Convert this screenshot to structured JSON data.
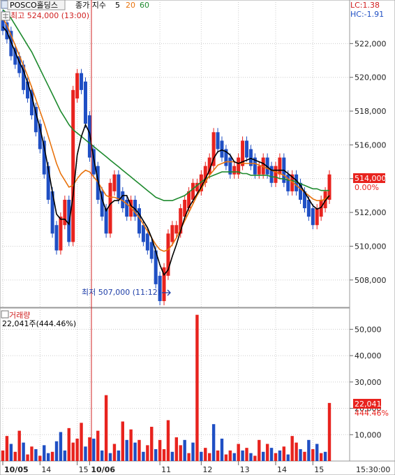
{
  "header": {
    "stock_name": "POSCO홀딩스",
    "series_label": "종가 지수",
    "ma_periods": [
      "5",
      "20",
      "60"
    ],
    "ma_colors": [
      "#000000",
      "#e8720c",
      "#1e8a2e"
    ],
    "high_label": "최고 524,000 (13:00)",
    "lc_label": "LC:1.38",
    "hc_label": "HC:-1.91"
  },
  "price_panel": {
    "current_price_label": "514,000",
    "current_change_label": "0.00%",
    "low_label": "최저 507,000 (11:12)",
    "y_ticks": [
      "522,000",
      "520,000",
      "518,000",
      "516,000",
      "514,000",
      "512,000",
      "510,000",
      "508,000"
    ]
  },
  "volume_panel": {
    "title": "거래량",
    "summary": "22,041주(444.46%)",
    "current_volume_label": "22,041",
    "current_ratio_label": "444.46%",
    "y_ticks": [
      "50,000",
      "40,000",
      "30,000",
      "20,000",
      "10,000"
    ]
  },
  "x_axis": {
    "labels": [
      "10/05",
      "14",
      "15",
      "10/06",
      "11",
      "12",
      "13",
      "14",
      "15"
    ],
    "time_label": "15:30:00"
  },
  "colors": {
    "up": "#e8231e",
    "down": "#1f4fc4",
    "ma5": "#000000",
    "ma20": "#e8720c",
    "ma60": "#1e8a2e",
    "marker": "#d02020",
    "axis_text": "#222222",
    "grid": "#cccccc"
  },
  "chart_data": [
    {
      "type": "bar",
      "title": "POSCO홀딩스 종가 지수",
      "description_series": [
        "close",
        "ma5",
        "ma20",
        "ma60"
      ],
      "x": [
        "10/05",
        "14",
        "15",
        "10/06",
        "11",
        "12",
        "13",
        "14",
        "15"
      ],
      "ylim": [
        507000,
        524000
      ],
      "close": [
        523000,
        522500,
        521500,
        521000,
        520500,
        519500,
        519000,
        518000,
        517000,
        516000,
        514500,
        513000,
        511000,
        510000,
        511500,
        512500,
        510500,
        519000,
        520000,
        519500,
        517500,
        515500,
        514500,
        513000,
        512000,
        511000,
        513500,
        514000,
        513000,
        512500,
        512000,
        512500,
        512000,
        511000,
        510500,
        510000,
        509500,
        508000,
        507000,
        508500,
        510500,
        511000,
        511000,
        512000,
        512500,
        513000,
        513500,
        513500,
        514000,
        514500,
        515000,
        516500,
        516000,
        515500,
        515000,
        514500,
        514500,
        515000,
        516000,
        515500,
        515000,
        514500,
        514500,
        515000,
        514500,
        514000,
        514500,
        515000,
        514000,
        513500,
        514000,
        513500,
        513000,
        512500,
        512000,
        511500,
        512000,
        512500,
        513000,
        514000
      ],
      "ma5": [
        523000,
        522700,
        522100,
        521500,
        520900,
        520400,
        519700,
        518900,
        517900,
        517000,
        515900,
        514600,
        513200,
        511900,
        511600,
        511600,
        511300,
        513000,
        515400,
        516500,
        517200,
        516700,
        515200,
        513900,
        512800,
        512100,
        512500,
        512700,
        512700,
        513000,
        513000,
        512400,
        512200,
        511900,
        511500,
        511100,
        510500,
        509700,
        508900,
        508300,
        508600,
        509400,
        510100,
        510900,
        511700,
        512300,
        512700,
        513100,
        513500,
        514000,
        514500,
        515200,
        515600,
        515700,
        515600,
        515400,
        515000,
        514900,
        515000,
        515100,
        515200,
        515100,
        515000,
        514900,
        514700,
        514500,
        514500,
        514500,
        514500,
        514300,
        514100,
        513900,
        513600,
        513200,
        512800,
        512400,
        512200,
        512300,
        512700,
        513000
      ],
      "ma20": [
        523500,
        523100,
        522500,
        521900,
        521300,
        520700,
        520100,
        519400,
        518700,
        518000,
        517300,
        516500,
        515700,
        514900,
        514300,
        513900,
        513500,
        513600,
        514000,
        514300,
        514500,
        514400,
        514100,
        513800,
        513400,
        513000,
        512900,
        512900,
        512800,
        512700,
        512500,
        512300,
        512000,
        511700,
        511300,
        510900,
        510500,
        510100,
        509800,
        509700,
        509800,
        510100,
        510500,
        511000,
        511500,
        512000,
        512500,
        513000,
        513400,
        513800,
        514200,
        514500,
        514800,
        514900,
        515000,
        515000,
        515000,
        514900,
        514900,
        514900,
        514900,
        514900,
        514800,
        514700,
        514600,
        514500,
        514400,
        514300,
        514200,
        514000,
        513800,
        513600,
        513400,
        513200,
        513000,
        512800,
        512700,
        512700,
        512800,
        513000
      ],
      "ma60": [
        524000,
        523800,
        523500,
        523100,
        522700,
        522300,
        521900,
        521500,
        521000,
        520500,
        520000,
        519500,
        519000,
        518500,
        518000,
        517600,
        517200,
        516900,
        516700,
        516500,
        516300,
        516100,
        515900,
        515700,
        515500,
        515300,
        515100,
        514900,
        514700,
        514500,
        514300,
        514100,
        513900,
        513700,
        513500,
        513300,
        513100,
        512900,
        512800,
        512700,
        512700,
        512700,
        512800,
        512900,
        513000,
        513200,
        513400,
        513600,
        513800,
        514000,
        514100,
        514200,
        514300,
        514400,
        514400,
        514400,
        514400,
        514400,
        514300,
        514300,
        514200,
        514200,
        514200,
        514200,
        514200,
        514100,
        514100,
        514000,
        514000,
        513900,
        513900,
        513800,
        513700,
        513600,
        513500,
        513400,
        513400,
        513300,
        513300,
        513300
      ]
    },
    {
      "type": "bar",
      "title": "거래량",
      "ylim": [
        0,
        57000
      ],
      "volume": [
        4000,
        9500,
        6500,
        3500,
        11500,
        7000,
        2500,
        5500,
        4500,
        2000,
        6000,
        3000,
        3500,
        7500,
        11000,
        4000,
        12500,
        7000,
        8500,
        14500,
        5500,
        9000,
        8500,
        11500,
        4000,
        25000,
        3000,
        6500,
        4000,
        15000,
        8000,
        12000,
        7000,
        8000,
        3500,
        6000,
        13000,
        4500,
        8000,
        4500,
        15500,
        3500,
        9000,
        6000,
        8000,
        3000,
        7000,
        55500,
        3500,
        5000,
        3000,
        14000,
        4000,
        8500,
        2500,
        4000,
        3000,
        6500,
        4000,
        5000,
        3000,
        2000,
        8000,
        3500,
        6500,
        5000,
        3000,
        4000,
        5500,
        2500,
        9500,
        7000,
        4500,
        3500,
        8000,
        4500,
        6500,
        3000,
        3500,
        22041
      ],
      "up": [
        true,
        true,
        false,
        true,
        true,
        false,
        true,
        true,
        false,
        true,
        false,
        false,
        true,
        false,
        false,
        false,
        true,
        true,
        true,
        true,
        false,
        true,
        false,
        true,
        false,
        true,
        false,
        true,
        false,
        true,
        false,
        true,
        false,
        true,
        false,
        true,
        true,
        false,
        true,
        true,
        true,
        false,
        true,
        true,
        false,
        true,
        false,
        true,
        false,
        true,
        true,
        false,
        true,
        false,
        true,
        true,
        false,
        true,
        false,
        true,
        false,
        true,
        true,
        false,
        true,
        false,
        true,
        false,
        true,
        false,
        true,
        true,
        false,
        true,
        false,
        true,
        false,
        true,
        false,
        true
      ]
    }
  ]
}
